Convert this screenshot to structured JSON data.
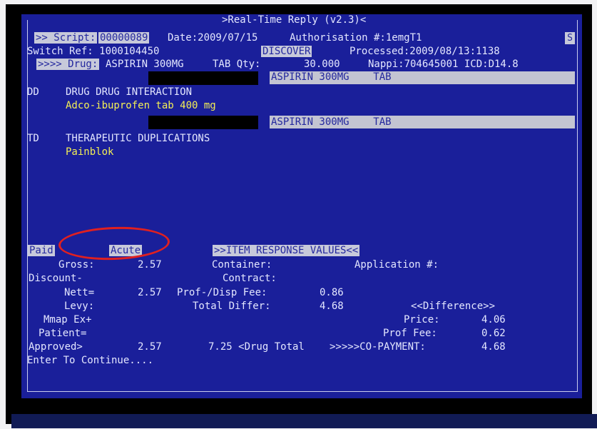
{
  "title": ">Real-Time Reply (v2.3)<",
  "header": {
    "script_tag": ">> Script:",
    "script_no": "00000089",
    "date": "Date:2009/07/15",
    "auth": "Authorisation #:1emgT1",
    "scroll_indicator": "S",
    "switch_ref": "Switch Ref: 1000104450",
    "scheme": "DISCOVER",
    "processed": "Processed:2009/08/13:1138",
    "drug_tag": ">>>> Drug:",
    "drug_name": "ASPIRIN 300MG",
    "drug_form": "TAB Qty:",
    "qty": "30.000",
    "nappi": "Nappi:704645001 ICD:D14.8"
  },
  "warnings": [
    {
      "bar_text": "ASPIRIN 300MG    TAB",
      "code": "DD",
      "heading": "DRUG DRUG INTERACTION",
      "detail": "Adco-ibuprofen tab 400 mg"
    },
    {
      "bar_text": "ASPIRIN 300MG    TAB",
      "code": "TD",
      "heading": "THERAPEUTIC DUPLICATIONS",
      "detail": "Painblok"
    }
  ],
  "status": {
    "paid": "Paid",
    "acute": "Acute",
    "response_header": ">>ITEM RESPONSE VALUES<<"
  },
  "values": {
    "gross_label": "Gross:",
    "gross": "2.57",
    "container_label": "Container:",
    "application_label": "Application #:",
    "discount_label": "Discount-",
    "contract_label": "Contract:",
    "nett_label": "Nett=",
    "nett": "2.57",
    "prof_fee_label": "Prof-/Disp Fee:",
    "prof_fee": "0.86",
    "levy_label": "Levy:",
    "total_differ_label": "Total Differ:",
    "total_differ": "4.68",
    "difference_header": "<<Difference>>",
    "mmap_label": "Mmap Ex+",
    "price_label": "Price:",
    "price": "4.06",
    "patient_label": "Patient=",
    "diff_prof_fee_label": "Prof Fee:",
    "diff_prof_fee": "0.62",
    "approved_label": "Approved>",
    "approved": "2.57",
    "drug_total": "7.25 <Drug Total",
    "copay_label": ">>>>>CO-PAYMENT:",
    "copay": "4.68"
  },
  "prompt": "Enter To Continue....",
  "accent_colors": {
    "background": "#1a1f9a",
    "text": "#e4e7ff",
    "highlight": "#f4ef55",
    "annotation": "#e02020"
  }
}
